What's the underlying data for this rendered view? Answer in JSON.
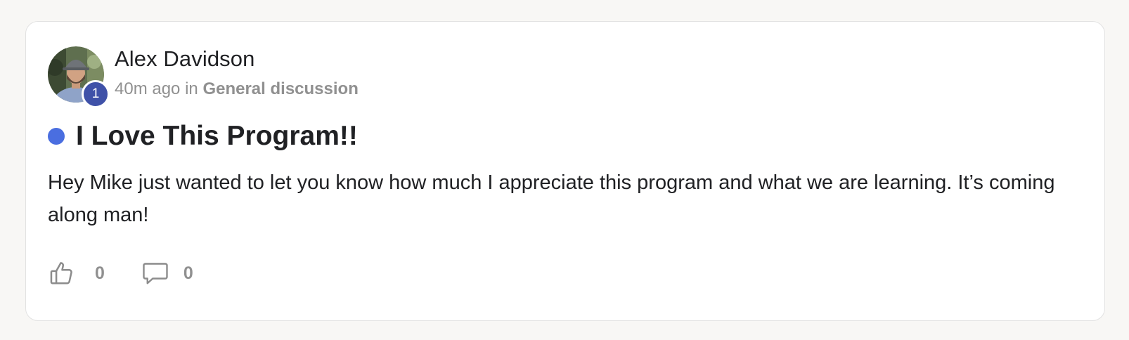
{
  "post": {
    "author": {
      "name": "Alex Davidson",
      "level": "1"
    },
    "meta": {
      "time_ago": "40m ago",
      "in_word": "in",
      "category": "General discussion"
    },
    "title": "I Love This Program!!",
    "body": "Hey Mike just wanted to let you know how much I appreciate this program and what we are learning. It’s coming along man!",
    "unread": true,
    "actions": {
      "like_icon": "thumbs-up-icon",
      "like_count": "0",
      "comment_icon": "comment-icon",
      "comment_count": "0"
    }
  },
  "colors": {
    "unread_dot": "#4a6ee0",
    "level_badge": "#3f51a8",
    "muted_text": "#909090",
    "card_border": "#e2e2e2",
    "page_background": "#f8f7f5"
  }
}
